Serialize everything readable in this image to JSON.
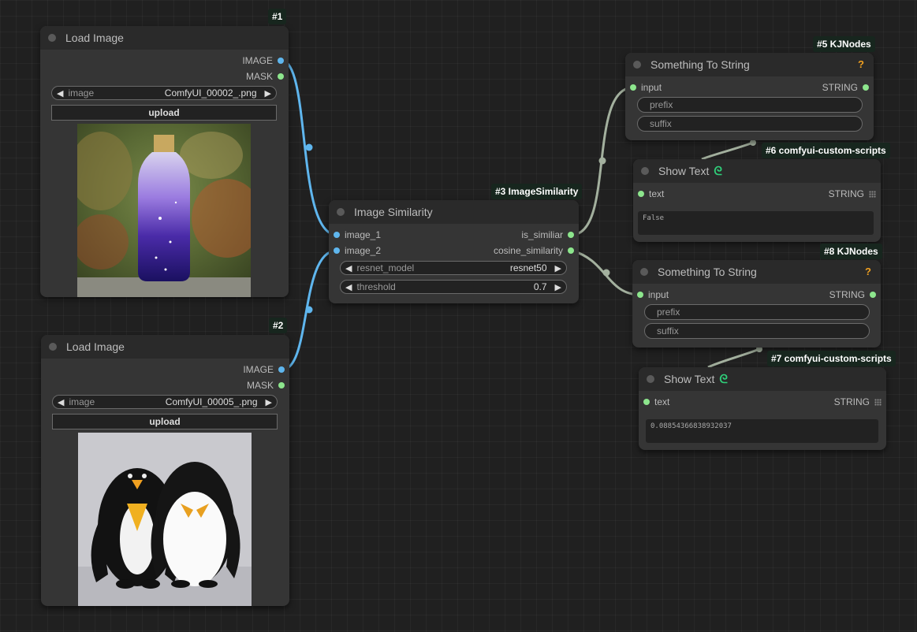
{
  "colors": {
    "image_wire": "#5fb6ee",
    "string_wire": "#a3b09e",
    "badge_bg": "#17261e",
    "warning": "#f0a020",
    "pysssss_icon": "#2fd07a"
  },
  "nodes": {
    "load_image_1": {
      "badge": "#1",
      "title": "Load Image",
      "outputs": [
        "IMAGE",
        "MASK"
      ],
      "image_widget": {
        "label": "image",
        "value": "ComfyUI_00002_.png"
      },
      "upload_label": "upload",
      "preview": "galaxy-water-bottle"
    },
    "load_image_2": {
      "badge": "#2",
      "title": "Load Image",
      "outputs": [
        "IMAGE",
        "MASK"
      ],
      "image_widget": {
        "label": "image",
        "value": "ComfyUI_00005_.png"
      },
      "upload_label": "upload",
      "preview": "penguin-plush-toys"
    },
    "image_similarity": {
      "badge": "#3 ImageSimilarity",
      "title": "Image Similarity",
      "inputs": [
        "image_1",
        "image_2"
      ],
      "outputs": [
        "is_similiar",
        "cosine_similarity"
      ],
      "widgets": [
        {
          "label": "resnet_model",
          "value": "resnet50"
        },
        {
          "label": "threshold",
          "value": "0.7"
        }
      ]
    },
    "something_to_string_5": {
      "badge": "#5 KJNodes",
      "title": "Something To String",
      "status_icon": "?",
      "input": "input",
      "output": "STRING",
      "fields": [
        "prefix",
        "suffix"
      ]
    },
    "show_text_6": {
      "badge": "#6 comfyui-custom-scripts",
      "title": "Show Text",
      "input": "text",
      "output": "STRING",
      "content": "False"
    },
    "something_to_string_8": {
      "badge": "#8 KJNodes",
      "title": "Something To String",
      "status_icon": "?",
      "input": "input",
      "output": "STRING",
      "fields": [
        "prefix",
        "suffix"
      ]
    },
    "show_text_7": {
      "badge": "#7 comfyui-custom-scripts",
      "title": "Show Text",
      "input": "text",
      "output": "STRING",
      "content": "0.08854366838932037"
    }
  }
}
